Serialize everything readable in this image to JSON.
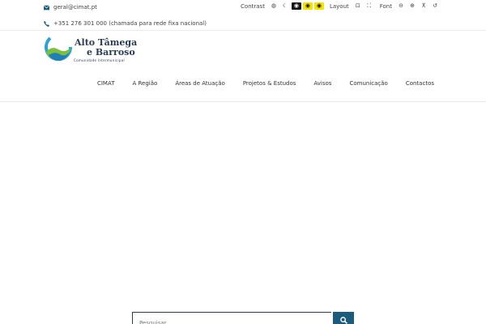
{
  "topbar": {
    "email": "geral@cimat.pt",
    "phone": "+351 276 301 000 (chamada para rede fixa nacional)"
  },
  "accessibility": {
    "contrast_label": "Contrast",
    "layout_label": "Layout",
    "font_label": "Font"
  },
  "logo": {
    "line1": "Alto Tâmega",
    "line2": "e Barroso",
    "line3": "Comunidade Intermunicipal"
  },
  "nav": {
    "items": [
      "CIMAT",
      "A Região",
      "Áreas de Atuação",
      "Projetos & Estudos",
      "Avisos",
      "Comunicação",
      "Contactos"
    ]
  },
  "search": {
    "placeholder": "Pesquisar ..."
  },
  "colors": {
    "brand_dark": "#2b3d56",
    "search_button": "#1b5c7c",
    "contrast_yellow": "#f7e300"
  }
}
